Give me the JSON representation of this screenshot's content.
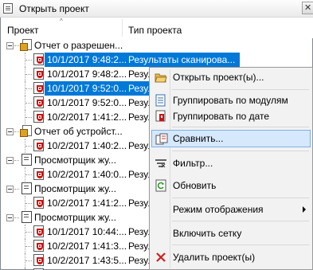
{
  "window": {
    "title": "Открыть проект"
  },
  "columns": {
    "project": "Проект",
    "type": "Тип проекта"
  },
  "tree": [
    {
      "kind": "group",
      "icon": "report-icon",
      "name": "Отчет о разрешен..."
    },
    {
      "kind": "child",
      "icon": "scan-icon",
      "name": "10/1/2017 9:48:2...",
      "type": "Результаты сканирова...",
      "selected": true
    },
    {
      "kind": "child",
      "icon": "scan-icon",
      "name": "10/1/2017 9:48:2...",
      "type": "Резул"
    },
    {
      "kind": "child",
      "icon": "scan-icon",
      "name": "10/1/2017 9:52:0...",
      "type": "Резул",
      "selected": true
    },
    {
      "kind": "child",
      "icon": "scan-icon",
      "name": "10/1/2017 9:52:0...",
      "type": "Резул"
    },
    {
      "kind": "child",
      "icon": "scan-icon",
      "name": "10/2/2017 1:41:2...",
      "type": "Резул"
    },
    {
      "kind": "group",
      "icon": "report-icon",
      "name": "Отчет об устройст..."
    },
    {
      "kind": "child",
      "icon": "scan-icon",
      "name": "10/2/2017 1:40:2...",
      "type": "Резул"
    },
    {
      "kind": "group",
      "icon": "viewer-icon",
      "name": "Просмотрщик жу..."
    },
    {
      "kind": "child",
      "icon": "scan-icon",
      "name": "10/2/2017 1:40:0...",
      "type": "Резул"
    },
    {
      "kind": "group",
      "icon": "viewer-icon",
      "name": "Просмотрщик жу..."
    },
    {
      "kind": "child",
      "icon": "scan-icon",
      "name": "10/2/2017 1:41:2...",
      "type": "Резул"
    },
    {
      "kind": "group",
      "icon": "viewer-icon",
      "name": "Просмотрщик жу..."
    },
    {
      "kind": "child",
      "icon": "scan-icon",
      "name": "10/1/2017 10:44:...",
      "type": "Резул"
    },
    {
      "kind": "child",
      "icon": "scan-icon",
      "name": "10/2/2017 1:41:3...",
      "type": "Резул"
    },
    {
      "kind": "child",
      "icon": "scan-icon",
      "name": "10/2/2017 1:43:5...",
      "type": "Резул"
    },
    {
      "kind": "child",
      "icon": "scan-icon",
      "name": "10/2/2017 1:41:2...",
      "type": "Резул"
    }
  ],
  "context_menu": {
    "open": "Открыть проект(ы)...",
    "group_by_module": "Группировать по модулям",
    "group_by_date": "Группировать по дате",
    "compare": "Сравнить...",
    "filter": "Фильтр...",
    "refresh": "Обновить",
    "display_mode": "Режим отображения",
    "enable_grid": "Включить сетку",
    "delete": "Удалить проект(ы)"
  },
  "colors": {
    "selection": "#0078d7",
    "menu_hover": "#d6e8fb",
    "delete_icon": "#d11f1f"
  }
}
